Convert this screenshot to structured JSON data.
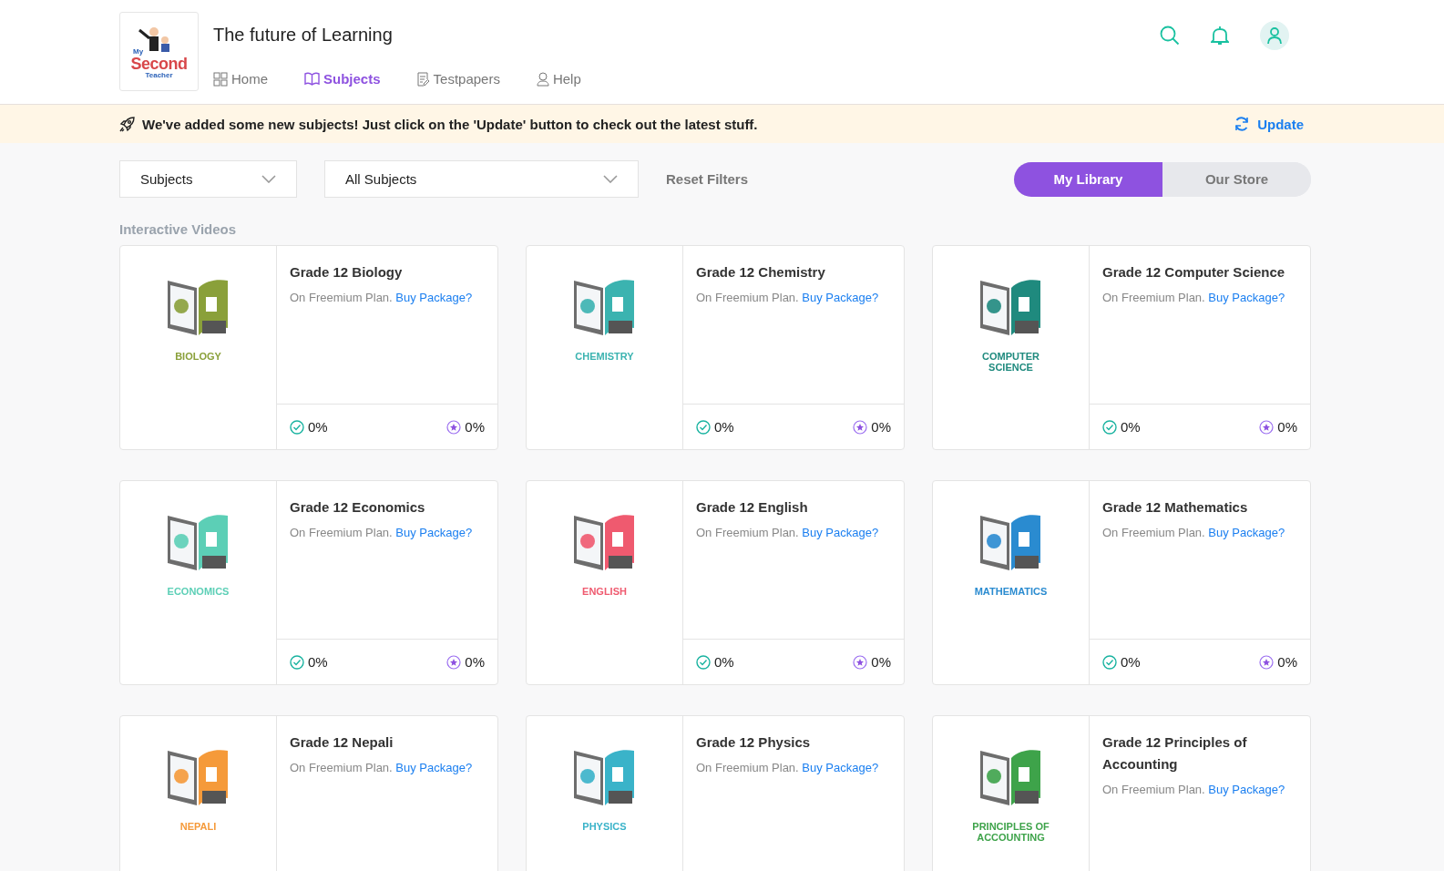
{
  "header": {
    "logo": {
      "lines": [
        "My",
        "Second",
        "Teacher"
      ]
    },
    "title": "The future of Learning",
    "nav": [
      {
        "label": "Home",
        "selected": false
      },
      {
        "label": "Subjects",
        "selected": true
      },
      {
        "label": "Testpapers",
        "selected": false
      },
      {
        "label": "Help",
        "selected": false
      }
    ]
  },
  "banner": {
    "message": "We've added some new subjects! Just click on the 'Update' button to check out the latest stuff.",
    "action": "Update"
  },
  "filters": {
    "type": "Subjects",
    "subject": "All Subjects",
    "reset": "Reset Filters"
  },
  "toggle": [
    {
      "label": "My Library",
      "selected": true
    },
    {
      "label": "Our Store",
      "selected": false
    }
  ],
  "section": "Interactive Videos",
  "cards": [
    {
      "title": "Grade 12 Biology",
      "caption": "BIOLOGY",
      "color": "#8aa03a",
      "plan": "On Freemium Plan.",
      "link": "Buy Package?",
      "done": "0%",
      "rating": "0%"
    },
    {
      "title": "Grade 12 Chemistry",
      "caption": "CHEMISTRY",
      "color": "#3bb3b0",
      "plan": "On Freemium Plan.",
      "link": "Buy Package?",
      "done": "0%",
      "rating": "0%"
    },
    {
      "title": "Grade 12 Computer Science",
      "caption": "COMPUTER SCIENCE",
      "color": "#1f8a7e",
      "plan": "On Freemium Plan.",
      "link": "Buy Package?",
      "done": "0%",
      "rating": "0%"
    },
    {
      "title": "Grade 12 Economics",
      "caption": "ECONOMICS",
      "color": "#5ccfb6",
      "plan": "On Freemium Plan.",
      "link": "Buy Package?",
      "done": "0%",
      "rating": "0%"
    },
    {
      "title": "Grade 12 English",
      "caption": "ENGLISH",
      "color": "#ef5a6f",
      "plan": "On Freemium Plan.",
      "link": "Buy Package?",
      "done": "0%",
      "rating": "0%"
    },
    {
      "title": "Grade 12 Mathematics",
      "caption": "MATHEMATICS",
      "color": "#2a8bd0",
      "plan": "On Freemium Plan.",
      "link": "Buy Package?",
      "done": "0%",
      "rating": "0%"
    },
    {
      "title": "Grade 12 Nepali",
      "caption": "NEPALI",
      "color": "#f59a3a",
      "plan": "On Freemium Plan.",
      "link": "Buy Package?"
    },
    {
      "title": "Grade 12 Physics",
      "caption": "PHYSICS",
      "color": "#3ab3c9",
      "plan": "On Freemium Plan.",
      "link": "Buy Package?"
    },
    {
      "title": "Grade 12 Principles of Accounting",
      "caption": "PRINCIPLES OF ACCOUNTING",
      "color": "#3ea34a",
      "plan": "On Freemium Plan.",
      "link": "Buy Package?"
    }
  ]
}
